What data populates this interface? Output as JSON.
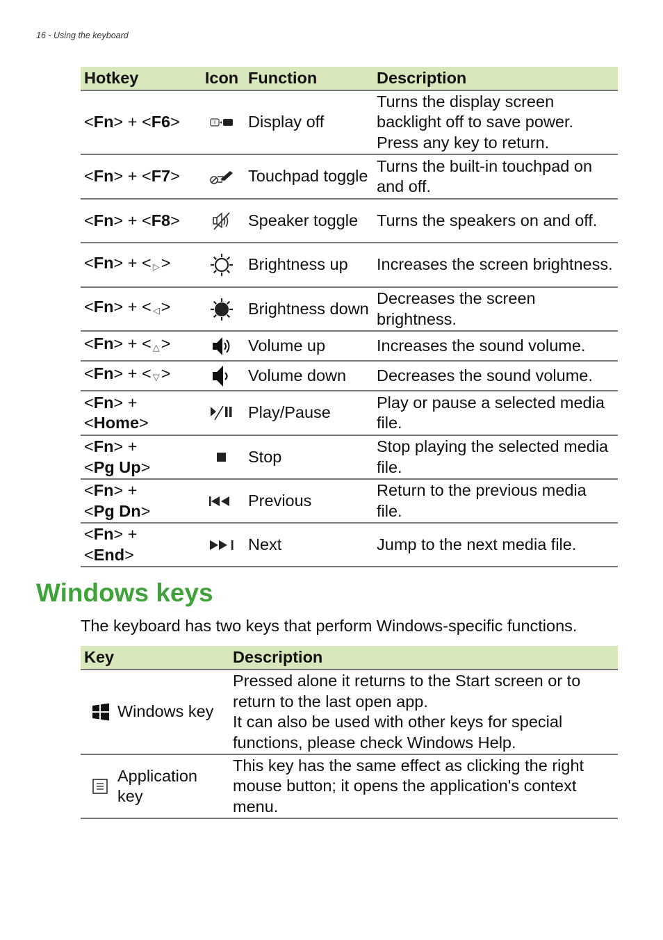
{
  "page_header": "16 - Using the keyboard",
  "hotkeys": {
    "headers": [
      "Hotkey",
      "Icon",
      "Function",
      "Description"
    ],
    "rows": [
      {
        "pre": "<",
        "fn": "Fn",
        "mid": "> + <",
        "key": "F6",
        "post": ">",
        "line2": "",
        "icon": "display-off-icon",
        "function": "Display off",
        "description": "Turns the display screen backlight off to save power. Press any key to return."
      },
      {
        "pre": "<",
        "fn": "Fn",
        "mid": "> + <",
        "key": "F7",
        "post": ">",
        "line2": "",
        "icon": "touchpad-toggle-icon",
        "function": "Touchpad toggle",
        "description": "Turns the built-in touchpad on and off."
      },
      {
        "pre": "<",
        "fn": "Fn",
        "mid": "> + <",
        "key": "F8",
        "post": ">",
        "line2": "",
        "icon": "speaker-toggle-icon",
        "function": "Speaker toggle",
        "description": "Turns the speakers on and off."
      },
      {
        "pre": "<",
        "fn": "Fn",
        "mid": "> + <",
        "key": "▷",
        "post": ">",
        "line2": "",
        "icon": "brightness-up-icon",
        "function": "Brightness up",
        "description": "Increases the screen brightness."
      },
      {
        "pre": "<",
        "fn": "Fn",
        "mid": "> + <",
        "key": "◁",
        "post": ">",
        "line2": "",
        "icon": "brightness-down-icon",
        "function": "Brightness down",
        "description": "Decreases the screen brightness."
      },
      {
        "pre": "<",
        "fn": "Fn",
        "mid": "> + <",
        "key": "△",
        "post": ">",
        "line2": "",
        "icon": "volume-up-icon",
        "function": "Volume up",
        "description": "Increases the sound volume."
      },
      {
        "pre": "<",
        "fn": "Fn",
        "mid": "> + <",
        "key": "▽",
        "post": ">",
        "line2": "",
        "icon": "volume-down-icon",
        "function": "Volume down",
        "description": "Decreases the sound volume."
      },
      {
        "pre": "<",
        "fn": "Fn",
        "mid": "> +",
        "key": "Home",
        "post": ">",
        "line2": "yes",
        "icon": "play-pause-icon",
        "function": "Play/Pause",
        "description": "Play or pause a selected media file."
      },
      {
        "pre": "<",
        "fn": "Fn",
        "mid": "> +",
        "key": "Pg Up",
        "post": ">",
        "line2": "yes",
        "icon": "stop-icon",
        "function": "Stop",
        "description": "Stop playing the selected media file."
      },
      {
        "pre": "<",
        "fn": "Fn",
        "mid": "> +",
        "key": "Pg Dn",
        "post": ">",
        "line2": "yes",
        "icon": "previous-icon",
        "function": "Previous",
        "description": "Return to the previous media file."
      },
      {
        "pre": "<",
        "fn": "Fn",
        "mid": "> +",
        "key": "End",
        "post": ">",
        "line2": "yes",
        "icon": "next-icon",
        "function": "Next",
        "description": "Jump to the next media file."
      }
    ]
  },
  "windows_section": {
    "title": "Windows keys",
    "intro": "The keyboard has two keys that perform Windows-specific functions.",
    "headers": [
      "Key",
      "Description"
    ],
    "rows": [
      {
        "icon": "windows-logo-icon",
        "key": "Windows key",
        "description": [
          "Pressed alone it returns to the Start screen or to return to the last open app.",
          "It can also be used with other keys for special functions, please check Windows Help."
        ]
      },
      {
        "icon": "application-menu-icon",
        "key": "Application key",
        "description": [
          "This key has the same effect as clicking the right mouse button; it opens the application's context menu."
        ]
      }
    ]
  },
  "colors": {
    "heading_green": "#3fa33a",
    "header_fill": "#d9e8bc",
    "rule": "#777777"
  }
}
